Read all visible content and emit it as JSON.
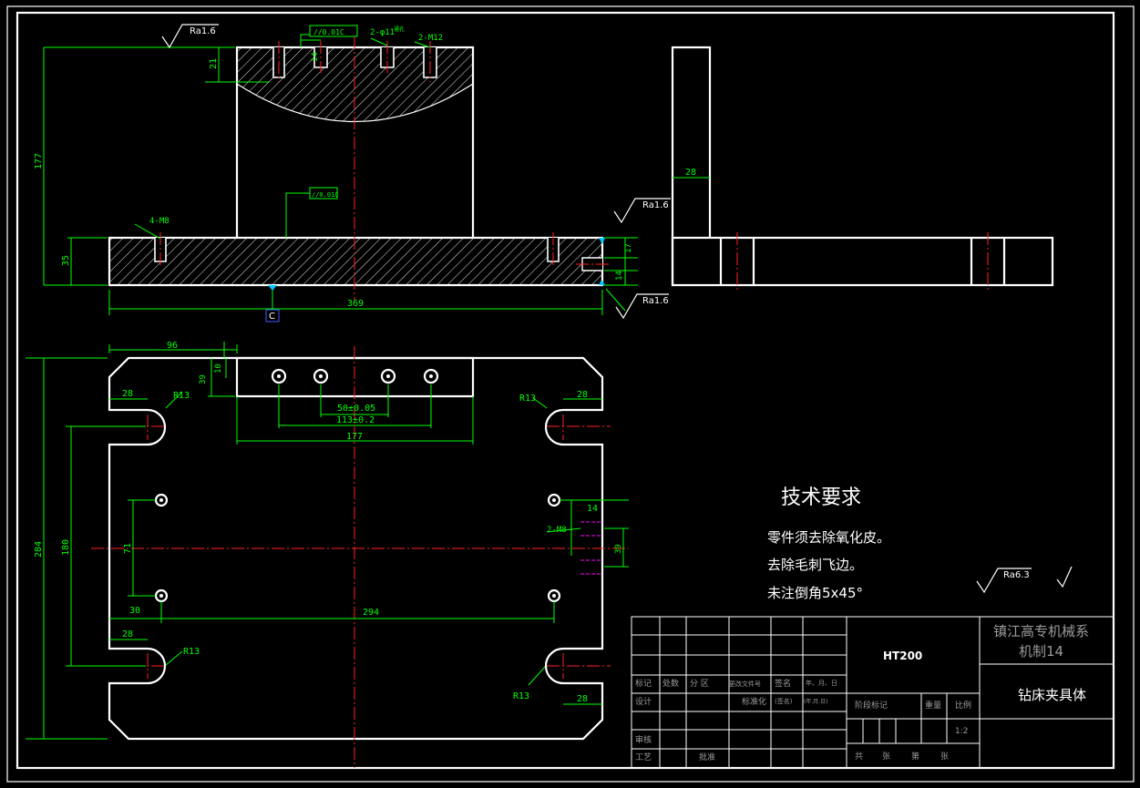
{
  "surface_finish": {
    "top_left": "Ra1.6",
    "right_upper": "Ra1.6",
    "right_lower": "Ra1.6",
    "general": "Ra6.3"
  },
  "datum_label": "C",
  "tolerance_frames": {
    "top_parallel": "//0.01C",
    "mid_parallel": "//0.01C"
  },
  "front_view_dims": {
    "height_total": "177",
    "base_height": "35",
    "top_depth": "21",
    "hole_depth": "14",
    "phi11": "2-φ11",
    "phi_note": "通孔",
    "m12": "2-M12",
    "m8": "4-M8",
    "right_17": "17",
    "right_14": "14",
    "length": "369"
  },
  "side_view_dims": {
    "thickness": "28"
  },
  "plan_view_dims": {
    "d96": "96",
    "d39": "39",
    "d10": "10",
    "d28_tl": "28",
    "r13_tl": "R13",
    "r13_tr": "R13",
    "d28_tr": "28",
    "d50": "50±0.05",
    "d113": "113±0.2",
    "d177": "177",
    "d284": "284",
    "d180": "180",
    "d71": "71",
    "d14": "14",
    "d2m8": "2-M8",
    "d39r": "39",
    "d30": "30",
    "d294": "294",
    "d28_bl": "28",
    "r13_bl": "R13",
    "r13_br": "R13",
    "d28_br": "28"
  },
  "tech_requirements": {
    "heading": "技术要求",
    "line1": "零件须去除氧化皮。",
    "line2": "去除毛刺飞边。",
    "line3": "未注倒角5x45°"
  },
  "title_block": {
    "material": "HT200",
    "school": "镇江高专机械系",
    "class_name": "机制14",
    "part_name": "钻床夹具体",
    "h_mark": "标记",
    "h_count": "处数",
    "h_zone": "分 区",
    "h_docno": "更改文件号",
    "h_sign": "签名",
    "h_date": "年、月、日",
    "h_design": "设计",
    "h_std": "标准化",
    "h_sign2": "(签名)",
    "h_date2": "(年.月.日)",
    "h_stage": "阶段标记",
    "h_weight": "重量",
    "h_scale": "比例",
    "scale": "1:2",
    "h_review": "审核",
    "h_craft": "工艺",
    "h_approve": "批准",
    "sheets_total": "共",
    "sheets_unit1": "张",
    "sheet_no": "第",
    "sheets_unit2": "张"
  }
}
